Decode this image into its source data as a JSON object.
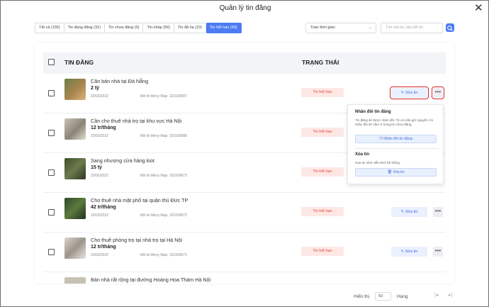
{
  "window": {
    "title": "Quản lý tin đăng"
  },
  "tabs": [
    {
      "label": "Tất cả (155)"
    },
    {
      "label": "Tin đang đăng (31)"
    },
    {
      "label": "Tin chưa đăng (0)"
    },
    {
      "label": "Tin nháp (56)"
    },
    {
      "label": "Tin đã hạ (23)"
    },
    {
      "label": "Tin hết hạn (43)",
      "active": true
    }
  ],
  "filters": {
    "time_value": "Toàn thời gian",
    "search_placeholder": "Tìm mã tin, tiêu đề tin"
  },
  "table": {
    "col_title": "TIN ĐĂNG",
    "col_status": "TRẠNG THÁI",
    "rows": [
      {
        "title": "Căn bán nhà tại Đà Nẵng",
        "price": "2 tỷ",
        "date": "23/03/2022",
        "code": "Mã tin Mexy Map: 101930587",
        "status": "Tin hết hạn",
        "edit": "Sửa tin"
      },
      {
        "title": "Cần cho thuê nhà trọ tại khu vực Hà Nội",
        "price": "12 tr/tháng",
        "date": "23/03/2022",
        "code": "Mã tin Mexy Map: 101930688",
        "status": "Tin hết hạn",
        "edit": "Sửa tin"
      },
      {
        "title": "Sang nhượng cửa hàng kiot",
        "price": "15 tỷ",
        "date": "23/03/2022",
        "code": "Mã tin Mexy Map: 101930673",
        "status": "Tin hết hạn",
        "edit": "Sửa tin"
      },
      {
        "title": "Cho thuê nhà mặt phố tại quận thủ Đức TP",
        "price": "42 tr/tháng",
        "date": "23/03/2022",
        "code": "Mã tin Mexy Map: 101930672",
        "status": "Tin hết hạn",
        "edit": "Sửa tin"
      },
      {
        "title": "Cho thuê phòng trọ tại nhà trọ tại Hà Nội",
        "price": "12 tr/tháng",
        "date": "23/03/2022",
        "code": "Mã tin Mexy Map: 101930671",
        "status": "Tin hết hạn",
        "edit": "Sửa tin"
      },
      {
        "title": "Bán nhà rất rộng tại đường Hoàng Hoa Thám Hà Nội",
        "price": "",
        "date": "",
        "code": "",
        "status": "",
        "edit": ""
      }
    ]
  },
  "popup": {
    "dup_title": "Nhân đôi tin đăng",
    "dup_desc": "Tin đăng sẽ được nhân đôi. Tin cũ vẫn giữ nguyên, tin nhân đôi sẽ nằm ở trong tin chưa đăng.",
    "dup_button": "Nhân đôi tin đăng",
    "del_title": "Xóa tin",
    "del_desc": "Xoá tin vĩnh viễn khỏi hệ thống",
    "del_button": "Xóa tin"
  },
  "footer": {
    "show_label": "Hiển thị",
    "page_size": "50",
    "rows_label": "Hàng"
  },
  "colors": {
    "accent": "#4d7cf2",
    "status_bg": "#fde8e6",
    "status_text": "#e0463a",
    "highlight": "#d9262c"
  }
}
